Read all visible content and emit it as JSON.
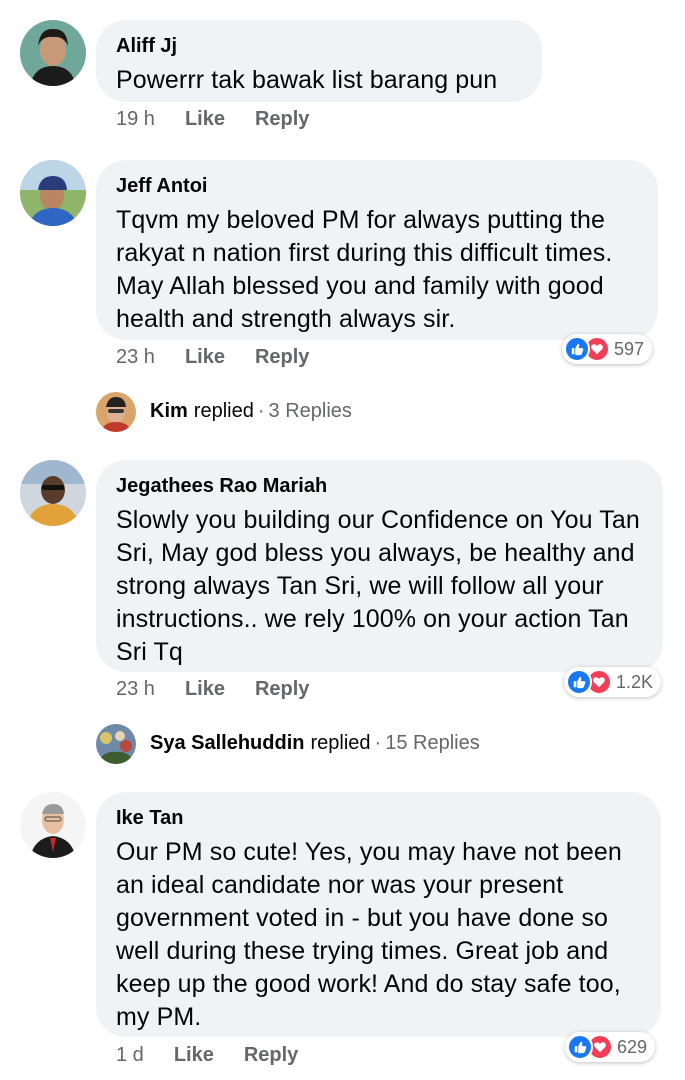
{
  "comments": [
    {
      "author": "Aliff Jj",
      "text": "Powerrr tak bawak list barang pun",
      "time": "19 h",
      "like": "Like",
      "reply": "Reply"
    },
    {
      "author": "Jeff Antoi",
      "text": "Tqvm my beloved PM for always putting the rakyat n nation first during this difficult times. May Allah blessed you and family with good health and strength always sir.",
      "time": "23 h",
      "like": "Like",
      "reply": "Reply",
      "reaction_count": "597",
      "replies": {
        "name": "Kim",
        "verb": "replied",
        "count": "3 Replies"
      }
    },
    {
      "author": "Jegathees Rao Mariah",
      "text": "Slowly you building our Confidence on You Tan Sri, May god bless you always, be healthy and strong always Tan Sri, we will follow all your instructions.. we rely 100% on your action Tan Sri  Tq",
      "time": "23 h",
      "like": "Like",
      "reply": "Reply",
      "reaction_count": "1.2K",
      "replies": {
        "name": "Sya Sallehuddin",
        "verb": "replied",
        "count": "15 Replies"
      }
    },
    {
      "author": "Ike Tan",
      "text": "Our PM so cute! Yes, you may have not been an ideal candidate nor was your present government voted in - but you have done so well during these trying times. Great job and keep up the good work! And do stay safe too, my PM.",
      "time": "1 d",
      "like": "Like",
      "reply": "Reply",
      "reaction_count": "629"
    }
  ],
  "icons": {
    "like": "thumbs-up-icon",
    "love": "heart-icon"
  },
  "colors": {
    "like": "#1877f2",
    "love": "#f33e58",
    "bubble": "#f0f2f5",
    "meta": "#65676b"
  }
}
